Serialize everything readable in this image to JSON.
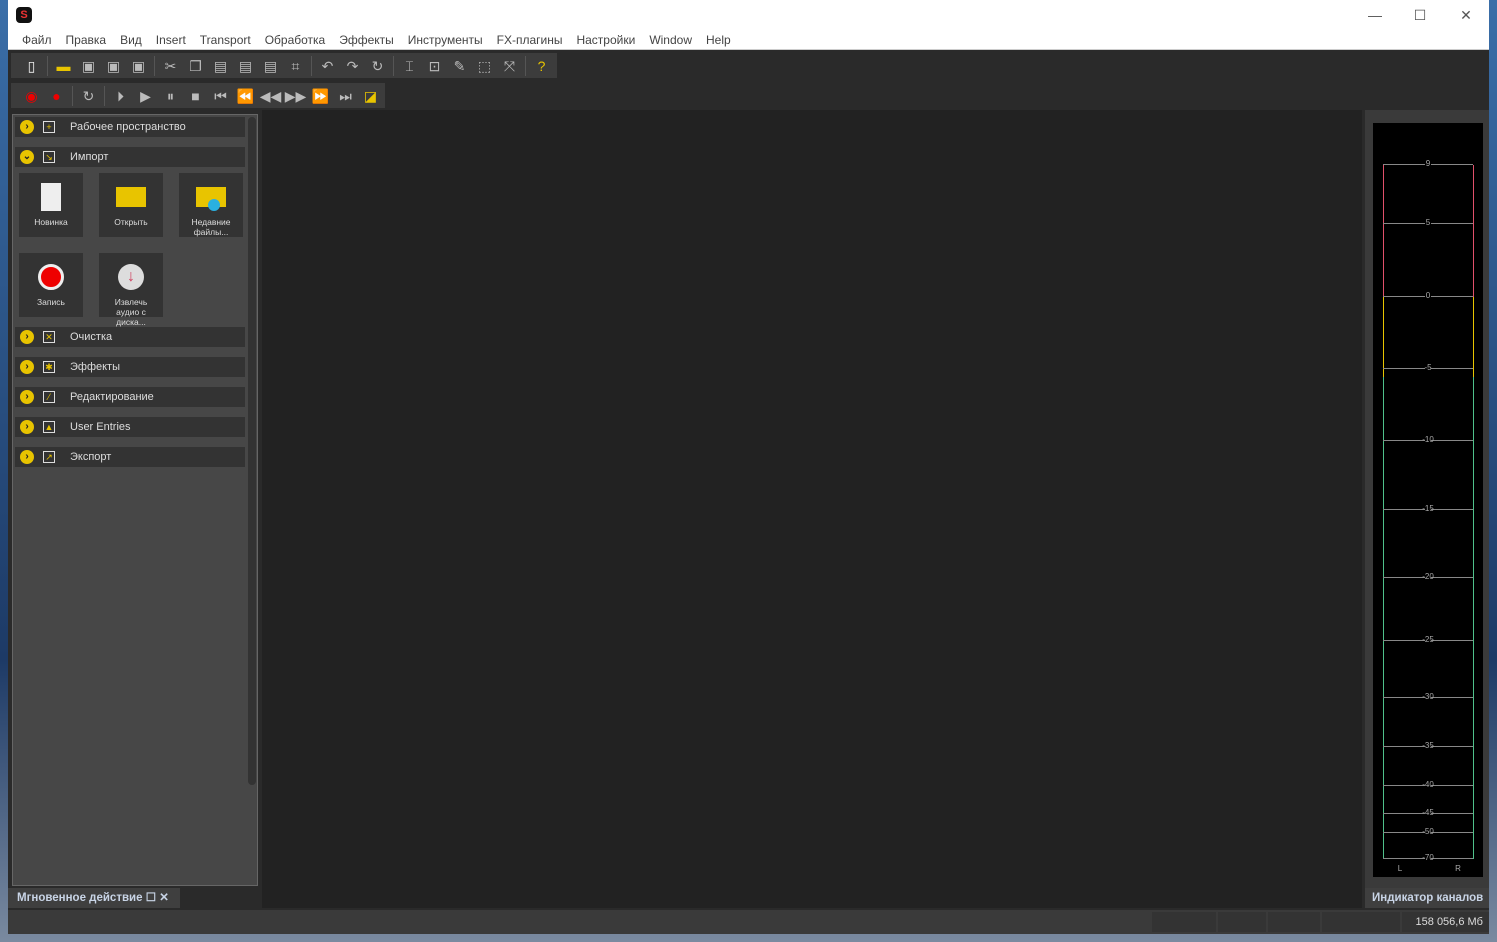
{
  "menu": [
    "Файл",
    "Правка",
    "Вид",
    "Insert",
    "Transport",
    "Обработка",
    "Эффекты",
    "Инструменты",
    "FX-плагины",
    "Настройки",
    "Window",
    "Help"
  ],
  "panel": {
    "sections": [
      {
        "label": "Рабочее пространство",
        "icon": "workspace-icon"
      },
      {
        "label": "Импорт",
        "icon": "import-icon"
      },
      {
        "label": "Очистка",
        "icon": "cleanup-icon"
      },
      {
        "label": "Эффекты",
        "icon": "effects-icon"
      },
      {
        "label": "Редактирование",
        "icon": "edit-icon"
      },
      {
        "label": "User Entries",
        "icon": "user-icon"
      },
      {
        "label": "Экспорт",
        "icon": "export-icon"
      }
    ],
    "tiles": [
      {
        "label": "Новинка"
      },
      {
        "label": "Открыть"
      },
      {
        "label": "Недавние файлы..."
      },
      {
        "label": "Запись"
      },
      {
        "label": "Извлечь аудио с диска..."
      }
    ]
  },
  "meter": {
    "labels": [
      "9",
      "5",
      "0",
      "-5",
      "-10",
      "-15",
      "-20",
      "-25",
      "-30",
      "-35",
      "-40",
      "-45",
      "-50",
      "-70"
    ],
    "channels": [
      "L",
      "R"
    ],
    "colors": {
      "red": "#e0506a",
      "yellow": "#e8c400",
      "green": "#4fc08a"
    }
  },
  "bottom": {
    "instant_action": "Мгновенное действие",
    "channel_meter": "Индикатор каналов"
  },
  "status": {
    "free_space": "158 056,6 Мб"
  }
}
